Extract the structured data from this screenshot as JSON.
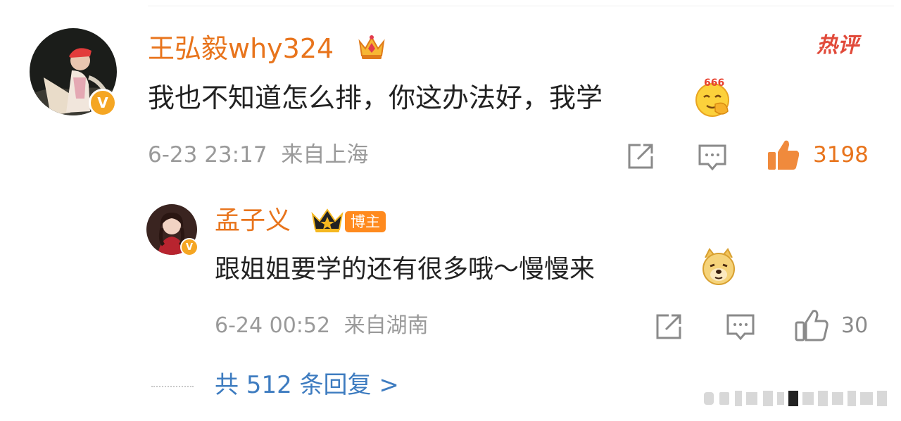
{
  "comment": {
    "username": "王弘毅why324",
    "hot_label": "热评",
    "text": "我也不知道怎么排，你这办法好，我学",
    "emoji_label": "666",
    "timestamp": "6-23 23:17",
    "location": "来自上海",
    "likes": "3198",
    "verified_mark": "V"
  },
  "reply": {
    "username": "孟子义",
    "badge": "博主",
    "text": "跟姐姐要学的还有很多哦～慢慢来",
    "timestamp": "6-24 00:52",
    "location": "来自湖南",
    "likes": "30",
    "verified_mark": "V"
  },
  "replies_link": "共 512 条回复 >",
  "colors": {
    "username": "#e8741c",
    "hot": "#e14a3a",
    "link": "#3e7cc0",
    "like_active": "#f08a3c",
    "meta": "#9a9a9a",
    "badge_bg": "#ff8a1e"
  },
  "icons": [
    "crown-icon",
    "share-icon",
    "comment-icon",
    "like-icon",
    "verified-icon",
    "emoji-666-icon",
    "emoji-doge-icon"
  ]
}
